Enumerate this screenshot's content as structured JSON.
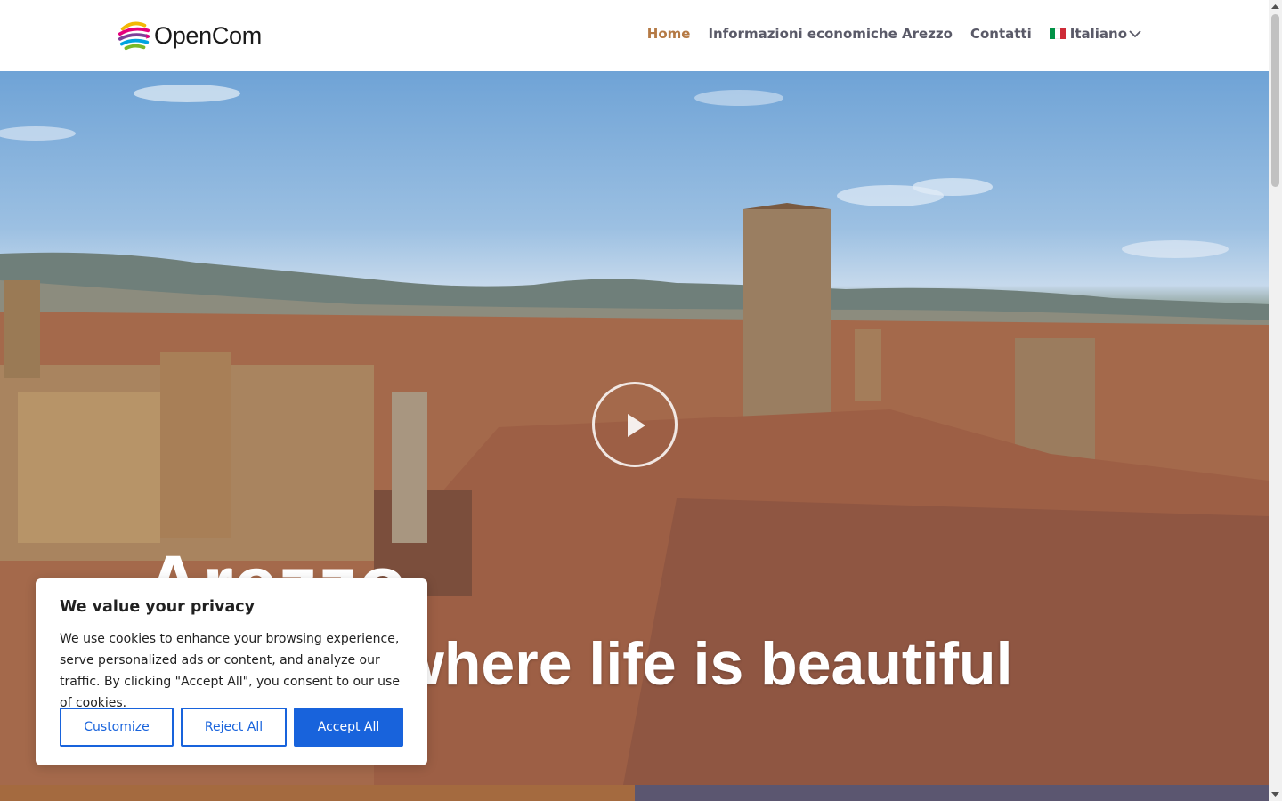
{
  "header": {
    "logo_text": "OpenCom",
    "nav": [
      {
        "label": "Home",
        "active": true
      },
      {
        "label": "Informazioni economiche Arezzo",
        "active": false
      },
      {
        "label": "Contatti",
        "active": false
      }
    ],
    "language": {
      "label": "Italiano",
      "flag_colors": [
        "#009246",
        "#ffffff",
        "#ce2b37"
      ]
    }
  },
  "hero": {
    "title": "Arezzo",
    "subtitle": "where life is beautiful",
    "play_icon": "play-icon"
  },
  "cookie_banner": {
    "title": "We value your privacy",
    "text": "We use cookies to enhance your browsing experience, serve personalized ads or content, and analyze our traffic. By clicking \"Accept All\", you consent to our use of cookies.",
    "buttons": {
      "customize": "Customize",
      "reject": "Reject All",
      "accept": "Accept All"
    },
    "accent_color": "#1863dc"
  },
  "colors": {
    "nav_active": "#b57a45",
    "nav_text": "#5a5a68",
    "bar_left": "#a46a3f",
    "bar_right": "#5b5670"
  }
}
